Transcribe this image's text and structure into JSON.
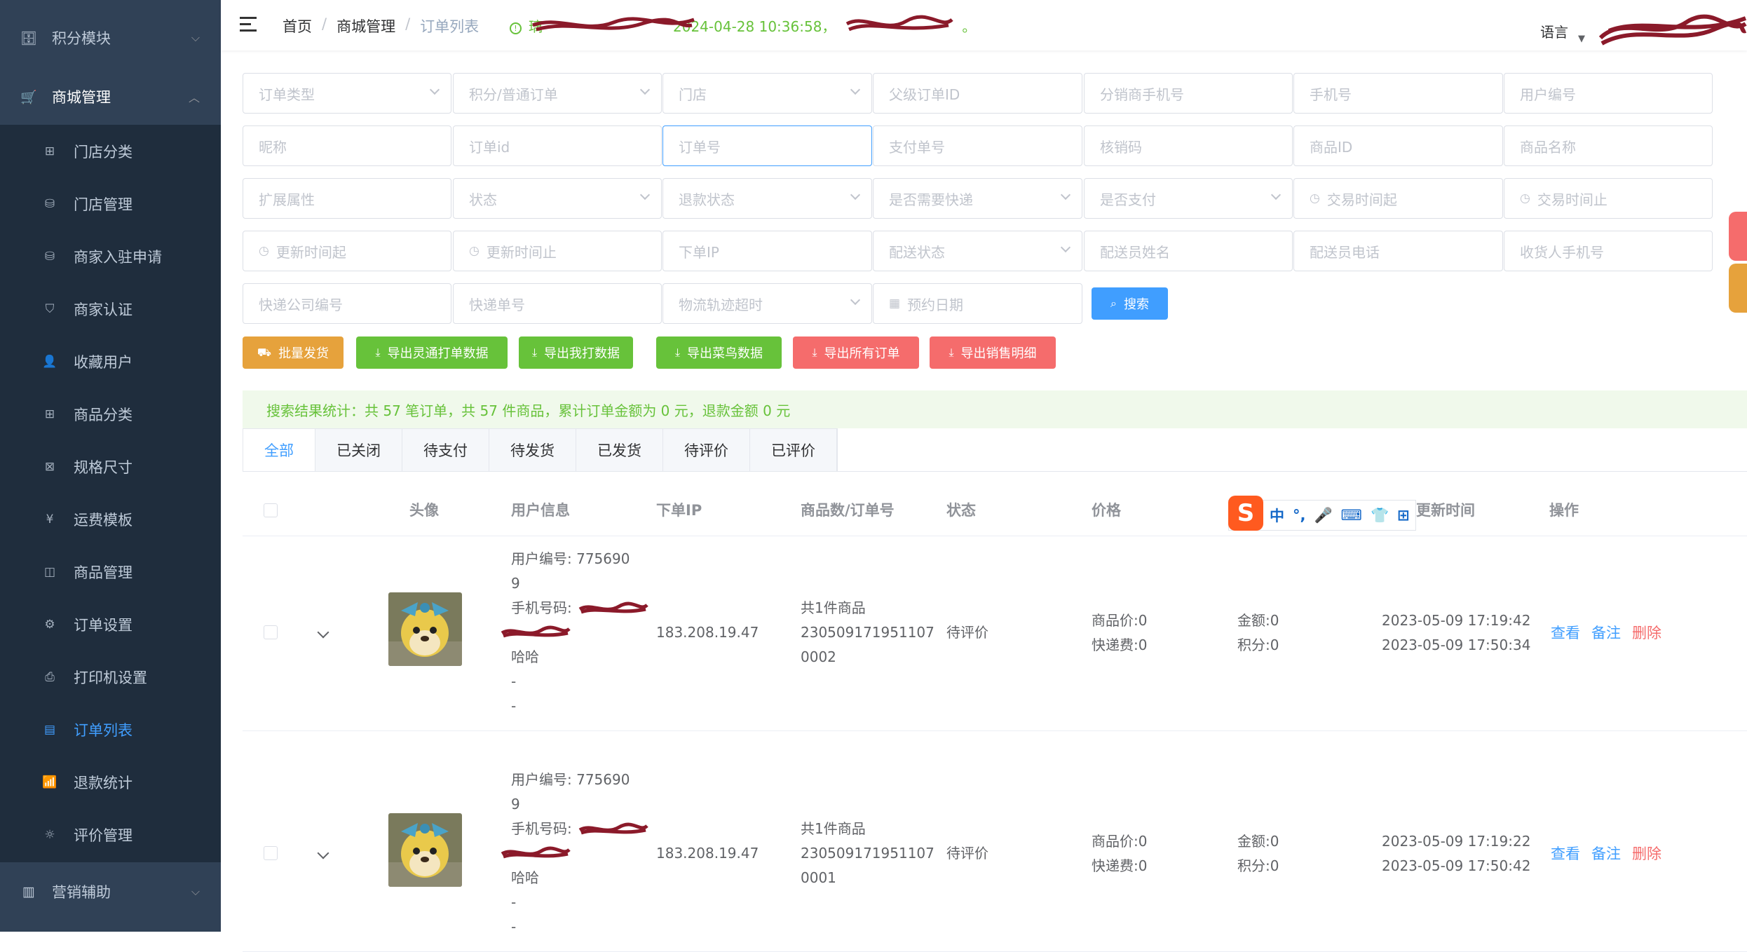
{
  "sidebar": {
    "group_points": "积分模块",
    "group_mall": "商城管理",
    "group_marketing": "营销辅助",
    "items": [
      {
        "label": "门店分类",
        "icon": "grid-icon"
      },
      {
        "label": "门店管理",
        "icon": "database-icon"
      },
      {
        "label": "商家入驻申请",
        "icon": "database-icon"
      },
      {
        "label": "商家认证",
        "icon": "shield-check-icon"
      },
      {
        "label": "收藏用户",
        "icon": "user-icon"
      },
      {
        "label": "商品分类",
        "icon": "grid-icon"
      },
      {
        "label": "规格尺寸",
        "icon": "ruler-icon"
      },
      {
        "label": "运费模板",
        "icon": "coin-icon"
      },
      {
        "label": "商品管理",
        "icon": "bag-icon"
      },
      {
        "label": "订单设置",
        "icon": "gear-icon"
      },
      {
        "label": "打印机设置",
        "icon": "printer-icon"
      },
      {
        "label": "订单列表",
        "icon": "document-icon"
      },
      {
        "label": "退款统计",
        "icon": "chart-icon"
      },
      {
        "label": "评价管理",
        "icon": "sun-icon"
      }
    ],
    "active_item": "订单列表"
  },
  "header": {
    "breadcrumb": [
      "首页",
      "商城管理",
      "订单列表"
    ],
    "notice_prefix": "璃",
    "notice_time": "2024-04-28 10:36:58，",
    "notice_suffix": "。",
    "language_label": "语言"
  },
  "filters": {
    "row1": [
      "订单类型",
      "积分/普通订单",
      "门店",
      "父级订单ID",
      "分销商手机号",
      "手机号",
      "用户编号"
    ],
    "row2": [
      "昵称",
      "订单id",
      "订单号",
      "支付单号",
      "核销码",
      "商品ID",
      "商品名称"
    ],
    "row3": [
      "扩展属性",
      "状态",
      "退款状态",
      "是否需要快递",
      "是否支付",
      "交易时间起",
      "交易时间止"
    ],
    "row4": [
      "更新时间起",
      "更新时间止",
      "下单IP",
      "配送状态",
      "配送员姓名",
      "配送员电话",
      "收货人手机号"
    ],
    "row5": [
      "快递公司编号",
      "快递单号",
      "物流轨迹超时",
      "预约日期"
    ],
    "search_label": "搜索"
  },
  "actions": {
    "batch_ship": "批量发货",
    "export_lingtong": "导出灵通打单数据",
    "export_wodawda": "导出我打数据",
    "export_cainiao": "导出菜鸟数据",
    "export_all": "导出所有订单",
    "export_sales": "导出销售明细"
  },
  "stats_text": "搜索结果统计：共 57 笔订单，共 57 件商品，累计订单金额为 0 元，退款金额 0 元",
  "tabs": [
    "全部",
    "已关闭",
    "待支付",
    "待发货",
    "已发货",
    "待评价",
    "已评价"
  ],
  "table": {
    "columns": [
      "头像",
      "用户信息",
      "下单IP",
      "商品数/订单号",
      "状态",
      "价格",
      "更新时间",
      "操作"
    ],
    "rows": [
      {
        "user_no_label": "用户编号: 775690",
        "user_no_cont": "9",
        "phone_label": "手机号码:",
        "nickname": "哈哈",
        "dash1": "-",
        "dash2": "-",
        "ip": "183.208.19.47",
        "goods_count": "共1件商品",
        "order_no_1": "230509171951107",
        "order_no_2": "0002",
        "status": "待评价",
        "goods_price": "商品价:0",
        "shipping_fee": "快递费:0",
        "amount": "金额:0",
        "points": "积分:0",
        "time_1": "2023-05-09 17:19:42",
        "time_2": "2023-05-09 17:50:34",
        "act_view": "查看",
        "act_note": "备注",
        "act_delete": "删除"
      },
      {
        "user_no_label": "用户编号: 775690",
        "user_no_cont": "9",
        "phone_label": "手机号码:",
        "nickname": "哈哈",
        "dash1": "-",
        "dash2": "-",
        "ip": "183.208.19.47",
        "goods_count": "共1件商品",
        "order_no_1": "230509171951107",
        "order_no_2": "0001",
        "status": "待评价",
        "goods_price": "商品价:0",
        "shipping_fee": "快递费:0",
        "amount": "金额:0",
        "points": "积分:0",
        "time_1": "2023-05-09 17:19:22",
        "time_2": "2023-05-09 17:50:42",
        "act_view": "查看",
        "act_note": "备注",
        "act_delete": "删除"
      }
    ]
  },
  "ime": {
    "logo": "S",
    "lang": "中",
    "punct": "°,"
  },
  "colors": {
    "sidebar": "#304156",
    "submenu": "#1f2d3d",
    "primary": "#409eff",
    "warning": "#e6a23c",
    "success": "#67c23a",
    "danger": "#f56c6c",
    "redact": "#8b1a2a"
  }
}
